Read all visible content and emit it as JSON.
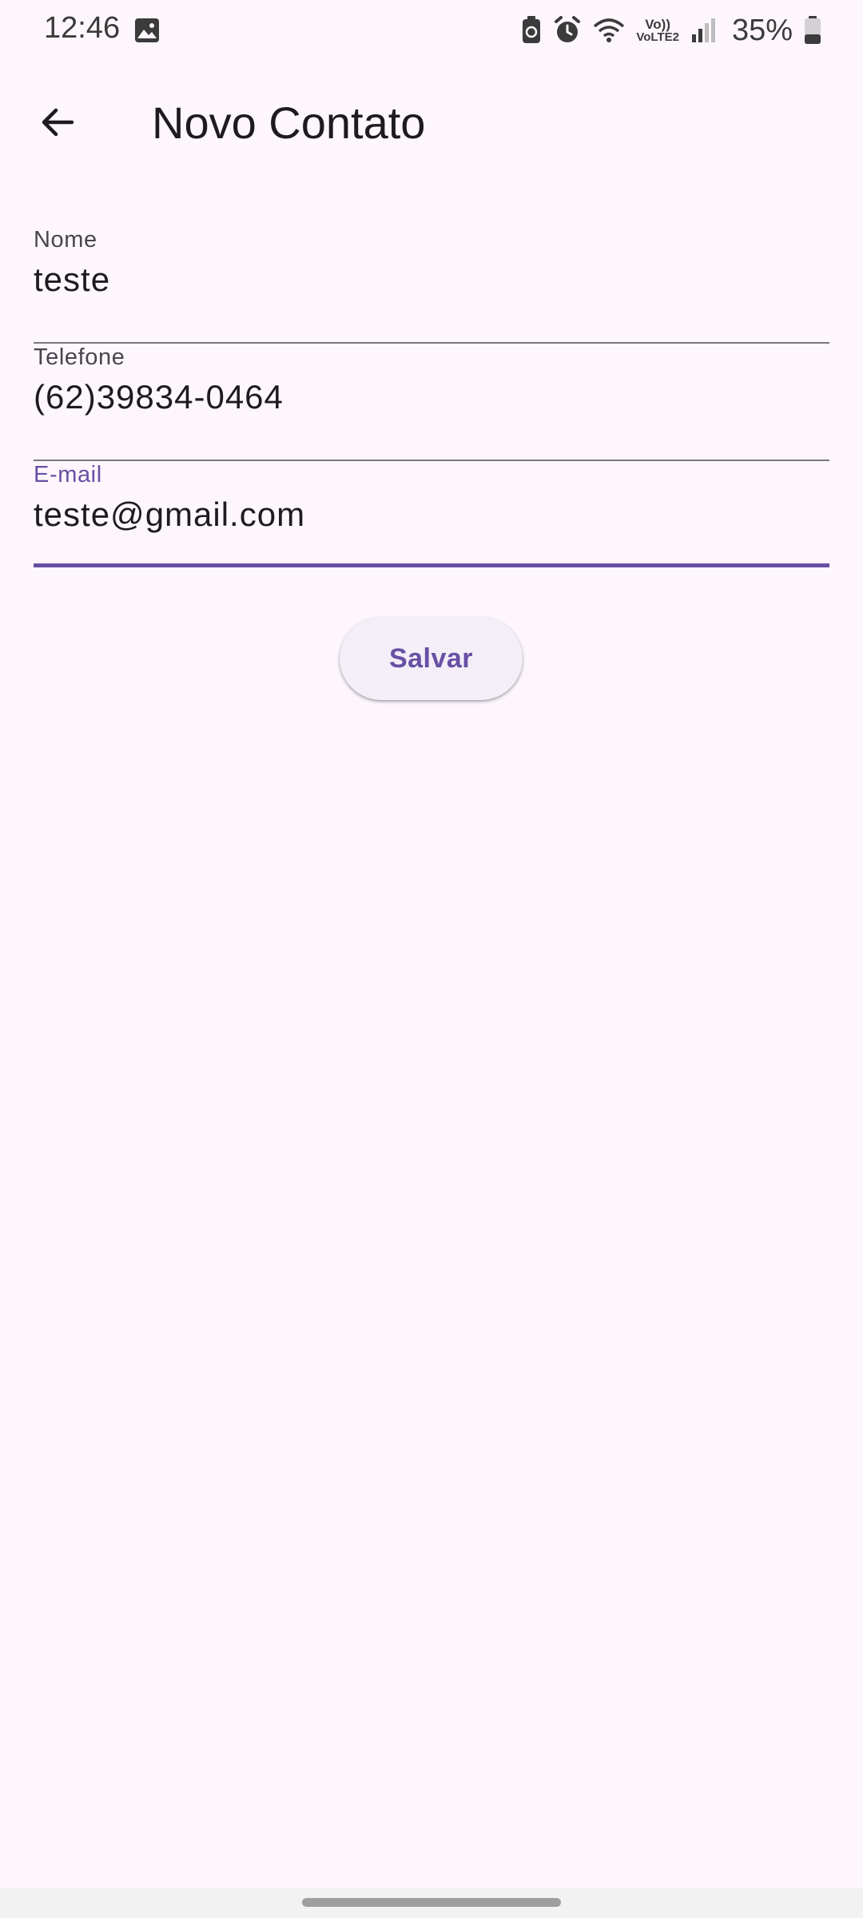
{
  "status_bar": {
    "time": "12:46",
    "battery_percent": "35%",
    "network_label": "VoLTE2",
    "icons": [
      "gallery-icon",
      "battery-saver-icon",
      "alarm-icon",
      "wifi-icon",
      "volte-icon",
      "signal-icon",
      "battery-icon"
    ]
  },
  "app_bar": {
    "title": "Novo Contato",
    "back_icon": "arrow-back-icon"
  },
  "form": {
    "fields": [
      {
        "label": "Nome",
        "value": "teste",
        "focused": false
      },
      {
        "label": "Telefone",
        "value": "(62)39834-0464",
        "focused": false
      },
      {
        "label": "E-mail",
        "value": "teste@gmail.com",
        "focused": true
      }
    ],
    "save_label": "Salvar"
  },
  "colors": {
    "accent": "#6750a4",
    "background": "#fdf7fd",
    "text": "#1d1b20",
    "label": "#49454f",
    "underline": "#79747e"
  }
}
